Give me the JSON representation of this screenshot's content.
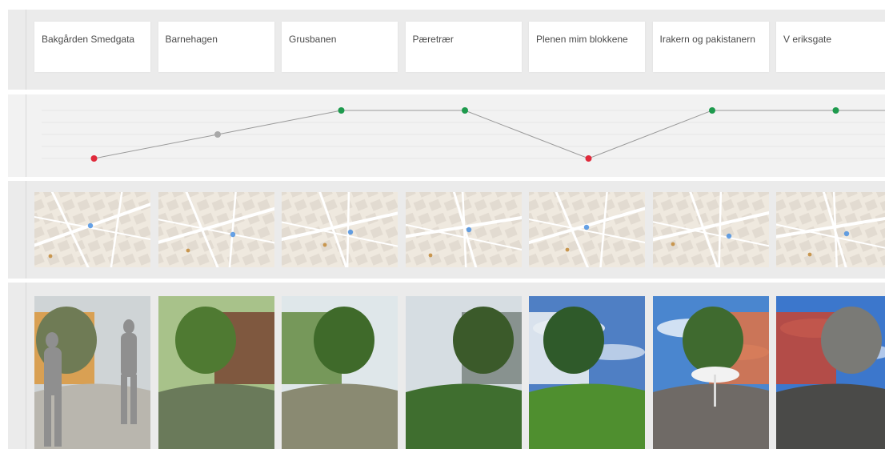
{
  "rows": {
    "cards_label": "",
    "chart_label": "",
    "maps_label": "",
    "photos_label": ""
  },
  "locations": [
    {
      "date": "",
      "title": "Bakgården Smedgata",
      "description": "",
      "rating": 1
    },
    {
      "date": "",
      "title": "Barnehagen",
      "description": "",
      "rating": 3
    },
    {
      "date": "",
      "title": "Grusbanen",
      "description": "",
      "rating": 5
    },
    {
      "date": "",
      "title": "Pæretrær",
      "description": "",
      "rating": 5
    },
    {
      "date": "",
      "title": "Plenen mim blokkene",
      "description": "",
      "rating": 1
    },
    {
      "date": "",
      "title": "Irakern og pakistanern",
      "description": "",
      "rating": 5
    },
    {
      "date": "",
      "title": "V eriksgate",
      "description": "",
      "rating": 5
    }
  ],
  "chart_data": {
    "type": "line",
    "x": [
      "Bakgården Smedgata",
      "Barnehagen",
      "Grusbanen",
      "Pæretrær",
      "Plenen mim blokkene",
      "Irakern og pakistanern",
      "V eriksgate"
    ],
    "values": [
      1,
      3,
      5,
      5,
      1,
      5,
      5
    ],
    "ylim": [
      1,
      5
    ],
    "grid": true,
    "point_colors": {
      "low": "#e02a3b",
      "mid": "#a9a9a9",
      "high": "#1e9a4d"
    },
    "line_color": "#9a9a9a"
  },
  "map_colors": {
    "land": "#efe9df",
    "block": "#e2dbd1",
    "road": "#ffffff",
    "pin": "#4a90e2",
    "poi": "#c8964f"
  }
}
